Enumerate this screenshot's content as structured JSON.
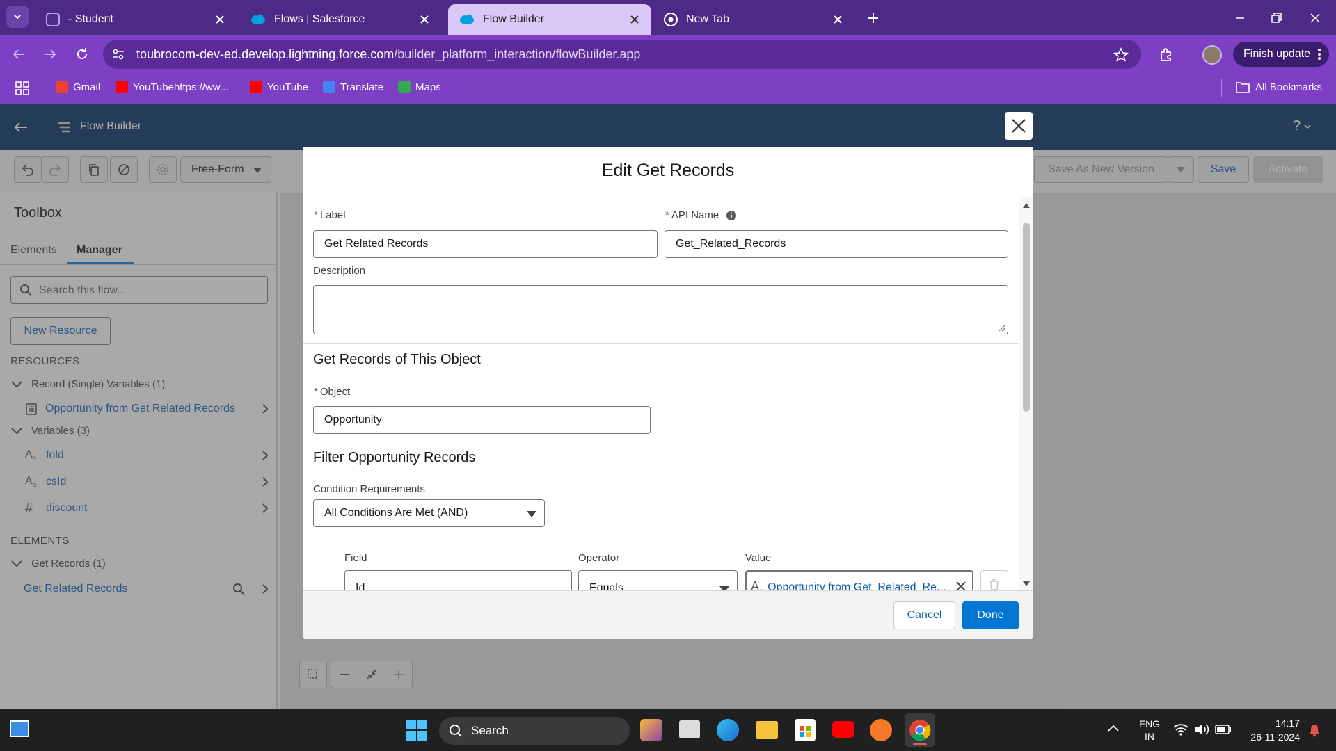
{
  "browser": {
    "tabs": [
      {
        "title": "- Student",
        "icon": "student-icon",
        "active": false
      },
      {
        "title": "Flows | Salesforce",
        "icon": "salesforce-cloud-icon",
        "active": false
      },
      {
        "title": "Flow Builder",
        "icon": "salesforce-cloud-icon",
        "active": true
      },
      {
        "title": "New Tab",
        "icon": "chrome-icon",
        "active": false
      }
    ],
    "url_host": "toubrocom-dev-ed.develop.lightning.force.com",
    "url_path": "/builder_platform_interaction/flowBuilder.app",
    "finish_update_label": "Finish update",
    "bookmarks": [
      {
        "label": "Gmail",
        "color": "#ea4335"
      },
      {
        "label": "YouTubehttps://ww...",
        "color": "#ff0000"
      },
      {
        "label": "YouTube",
        "color": "#ff0000"
      },
      {
        "label": "Translate",
        "color": "#4285f4"
      },
      {
        "label": "Maps",
        "color": "#34a853"
      }
    ],
    "all_bookmarks_label": "All Bookmarks"
  },
  "app": {
    "title": "Flow Builder",
    "help_label": "?",
    "layout_mode": "Free-Form",
    "save_as_new_version_label": "Save As New Version",
    "save_label": "Save",
    "activate_label": "Activate"
  },
  "toolbox": {
    "title": "Toolbox",
    "tabs": [
      {
        "label": "Elements",
        "active": false
      },
      {
        "label": "Manager",
        "active": true
      }
    ],
    "search_placeholder": "Search this flow...",
    "new_resource_label": "New Resource",
    "resources_heading": "RESOURCES",
    "record_vars_group": "Record (Single) Variables (1)",
    "record_vars": [
      "Opportunity from Get Related Records"
    ],
    "variables_group": "Variables (3)",
    "variables": [
      {
        "name": "fold",
        "type": "text"
      },
      {
        "name": "csId",
        "type": "text"
      },
      {
        "name": "discount",
        "type": "number"
      }
    ],
    "elements_heading": "ELEMENTS",
    "get_records_group": "Get Records (1)",
    "get_records_items": [
      "Get Related Records"
    ]
  },
  "modal": {
    "title": "Edit Get Records",
    "label_label": "Label",
    "label_value": "Get Related Records",
    "api_name_label": "API Name",
    "api_name_value": "Get_Related_Records",
    "description_label": "Description",
    "description_value": "",
    "object_section_title": "Get Records of This Object",
    "object_label": "Object",
    "object_value": "Opportunity",
    "filter_section_title": "Filter Opportunity Records",
    "condition_req_label": "Condition Requirements",
    "condition_req_value": "All Conditions Are Met (AND)",
    "field_col_label": "Field",
    "operator_col_label": "Operator",
    "value_col_label": "Value",
    "condition_field_value": "Id",
    "condition_operator_value": "Equals",
    "condition_value_value": "Opportunity from Get_Related_Re...",
    "cancel_label": "Cancel",
    "done_label": "Done"
  },
  "taskbar": {
    "search_label": "Search",
    "lang_line1": "ENG",
    "lang_line2": "IN",
    "time": "14:17",
    "date": "26-11-2024"
  },
  "colors": {
    "tab_bar": "#4b2b86",
    "address_bar": "#7d3fc4",
    "sf_header": "#032d60",
    "brand_blue": "#0176d3",
    "link_blue": "#0b5cab"
  }
}
